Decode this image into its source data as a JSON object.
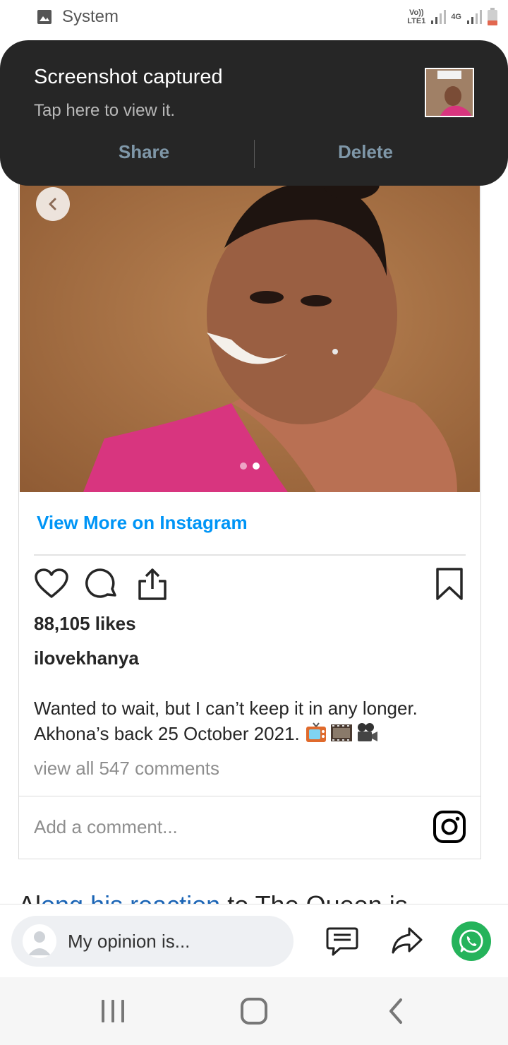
{
  "status_bar": {
    "app_name": "System",
    "app_icon": "image-icon",
    "sim1_label": "Vo))\nLTE1",
    "sim2_label": "4G"
  },
  "notification": {
    "title": "Screenshot captured",
    "subtitle": "Tap here to view it.",
    "share_label": "Share",
    "delete_label": "Delete"
  },
  "instagram_embed": {
    "carousel_dots": 2,
    "carousel_active": 2,
    "view_more_label": "View More on Instagram",
    "likes": "88,105 likes",
    "username": "ilovekhanya",
    "caption": "Wanted to wait, but I can’t keep it in any longer. Akhona’s back 25 October 2021.",
    "caption_emoji": "📺🎞️🎥",
    "view_comments": "view all 547 comments",
    "add_comment_placeholder": "Add a comment..."
  },
  "article_snippet": {
    "before_link": "Al",
    "link_text": "ong  his  reaction",
    "after_link": "  to  The  Queen  is"
  },
  "comment_bar": {
    "placeholder": "My opinion is..."
  },
  "colors": {
    "notification_bg": "#262626",
    "notification_action": "#7f97a8",
    "instagram_link": "#0095f6",
    "whatsapp_green": "#25b35b"
  }
}
